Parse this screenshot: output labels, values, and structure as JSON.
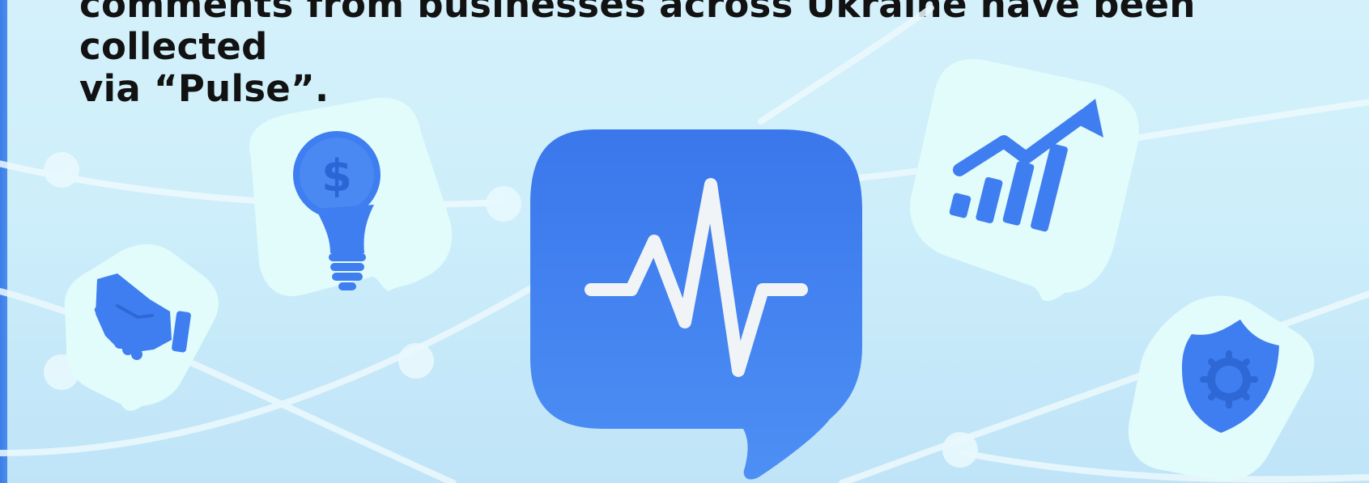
{
  "headline": {
    "line1": "comments from businesses across Ukraine have been collected",
    "line2": "via “Pulse”."
  },
  "icons": {
    "center": "pulse-chat-icon",
    "lightbulb": "idea-dollar-lightbulb-icon",
    "handshake": "handshake-icon",
    "chart": "growth-chart-icon",
    "shield": "security-shield-gear-icon"
  },
  "colors": {
    "background": "#cdeefa",
    "accent_blue": "#3f7ef0",
    "tile": "#e2fbfb",
    "text": "#121212",
    "network_line": "#ecf9fd"
  }
}
